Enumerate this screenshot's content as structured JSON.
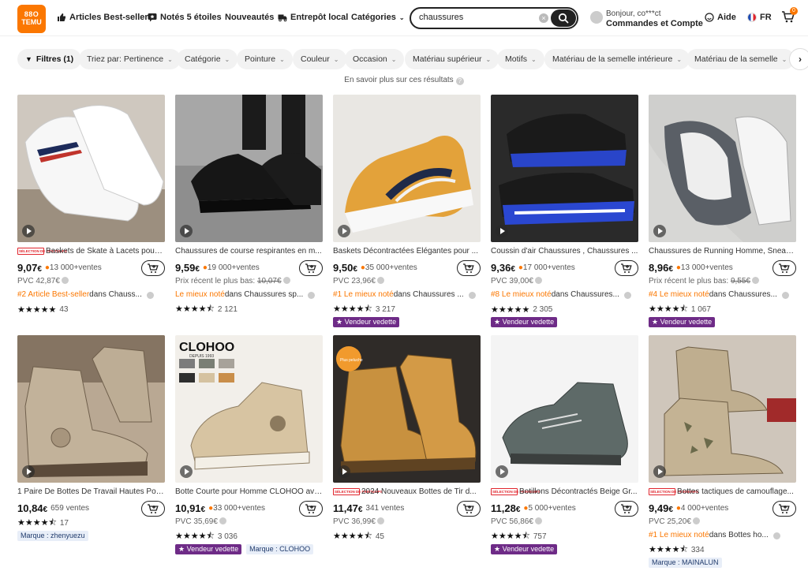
{
  "header": {
    "logo_line1": "88O",
    "logo_line2": "TEMU",
    "nav": {
      "best_sellers": "Articles Best-seller",
      "five_stars": "Notés 5 étoiles",
      "new": "Nouveautés",
      "local_warehouse": "Entrepôt local",
      "categories": "Catégories"
    },
    "search": {
      "value": "chaussures"
    },
    "account": {
      "greeting": "Bonjour, co***ct",
      "label": "Commandes et Compte"
    },
    "help": "Aide",
    "language": "FR",
    "cart_count": "0"
  },
  "filters": {
    "chips": [
      "Filtres (1)",
      "Triez par: Pertinence",
      "Catégorie",
      "Pointure",
      "Couleur",
      "Occasion",
      "Matériau supérieur",
      "Motifs",
      "Matériau de la semelle intérieure",
      "Matériau de la semelle"
    ],
    "info": "En savoir plus sur ces résultats"
  },
  "selection_badge": "SÉLECTION DE PRINTEMPS",
  "products": [
    {
      "title": "Baskets de Skate à Lacets pour ...",
      "selection": true,
      "price_int": "9,07",
      "currency": "€",
      "sales": "13 000+ventes",
      "line": "PVC 42,87€",
      "rank_highlight": "#2 Article Best-seller",
      "rank_rest": " dans Chauss...",
      "rating": 4.8,
      "reviews": "43",
      "vedette": "",
      "marque": "",
      "image": "white-sneakers"
    },
    {
      "title": "Chaussures de course respirantes en m...",
      "selection": false,
      "price_int": "9,59",
      "currency": "€",
      "sales": "19 000+ventes",
      "line_prefix": "Prix récent le plus bas: ",
      "line_strike": "10,07€",
      "rank_highlight": "Le mieux noté",
      "rank_rest": " dans Chaussures sp...",
      "rating": 4.5,
      "reviews": "2 121",
      "vedette": "",
      "marque": "",
      "image": "black-runners"
    },
    {
      "title": "Baskets Décontractées Élégantes pour ...",
      "selection": false,
      "price_int": "9,50",
      "currency": "€",
      "sales": "35 000+ventes",
      "line": "PVC 23,96€",
      "rank_highlight": "#1 Le mieux noté",
      "rank_rest": " dans Chaussures ...",
      "rating": 4.5,
      "reviews": "3 217",
      "vedette": "Vendeur vedette",
      "marque": "",
      "image": "yellow-sneaker"
    },
    {
      "title": "Coussin d'air Chaussures , Chaussures ...",
      "selection": false,
      "price_int": "9,36",
      "currency": "€",
      "sales": "17 000+ventes",
      "line": "PVC 39,00€",
      "rank_highlight": "#8 Le mieux noté",
      "rank_rest": " dans Chaussures...",
      "rating": 4.8,
      "reviews": "2 305",
      "vedette": "Vendeur vedette",
      "marque": "",
      "image": "blue-air"
    },
    {
      "title": "Chaussures de Running Homme, Sneake...",
      "selection": false,
      "price_int": "8,96",
      "currency": "€",
      "sales": "13 000+ventes",
      "line_prefix": "Prix récent le plus bas: ",
      "line_strike": "9,55€",
      "rank_highlight": "#4 Le mieux noté",
      "rank_rest": " dans Chaussures...",
      "rating": 4.5,
      "reviews": "1 067",
      "vedette": "Vendeur vedette",
      "marque": "",
      "image": "grey-runners"
    },
    {
      "title": "1 Paire De Bottes De Travail Hautes Pour...",
      "selection": false,
      "price_int": "10,84",
      "currency": "€",
      "sales": "659 ventes",
      "line": "",
      "rank_highlight": "",
      "rank_rest": "",
      "rating": 4.5,
      "reviews": "17",
      "vedette": "",
      "marque": "Marque : zhenyuezu",
      "image": "tan-boots"
    },
    {
      "title": "Botte Courte pour Homme CLOHOO ave...",
      "selection": false,
      "price_int": "10,91",
      "currency": "€",
      "sales": "33 000+ventes",
      "line": "PVC 35,69€",
      "rank_highlight": "",
      "rank_rest": "",
      "rating": 4.5,
      "reviews": "3 036",
      "vedette": "Vendeur vedette",
      "marque": "Marque : CLOHOO",
      "image": "clohoo",
      "brand_text": "CLOHOO",
      "brand_sub": "DEPUIS 1993"
    },
    {
      "title": "2024 Nouveaux Bottes de Tir d...",
      "selection": true,
      "price_int": "11,47",
      "currency": "€",
      "sales": "341 ventes",
      "line": "PVC 36,99€",
      "rank_highlight": "",
      "rank_rest": "",
      "rating": 4.5,
      "reviews": "45",
      "vedette": "",
      "marque": "",
      "image": "wheat-boots",
      "badge_text": "Plus peluche"
    },
    {
      "title": "Botillons Décontractés Beige Gr...",
      "selection": true,
      "price_int": "11,28",
      "currency": "€",
      "sales": "5 000+ventes",
      "line": "PVC 56,86€",
      "rank_highlight": "",
      "rank_rest": "",
      "rating": 4.5,
      "reviews": "757",
      "vedette": "Vendeur vedette",
      "marque": "",
      "image": "grey-boot"
    },
    {
      "title": "Bottes tactiques de camouflage...",
      "selection": true,
      "price_int": "9,49",
      "currency": "€",
      "sales": "4 000+ventes",
      "line": "PVC 25,20€",
      "rank_highlight": "#1 Le mieux noté",
      "rank_rest": " dans Bottes ho...",
      "rating": 4.5,
      "reviews": "334",
      "vedette": "",
      "marque": "Marque : MAINALUN",
      "image": "camo-boots"
    }
  ]
}
